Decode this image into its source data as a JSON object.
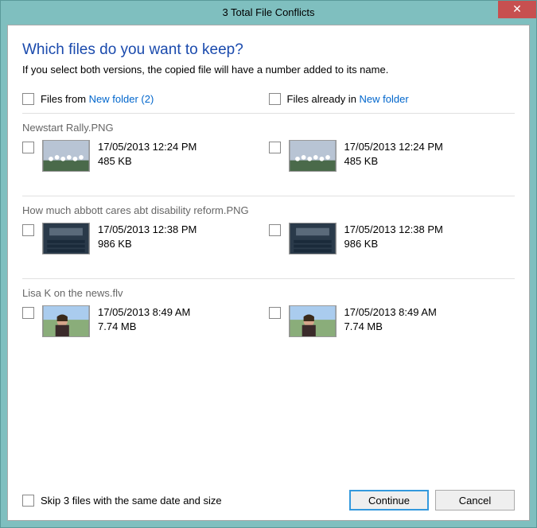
{
  "title": "3 Total File Conflicts",
  "close_icon_char": "✕",
  "heading": "Which files do you want to keep?",
  "subheading": "If you select both versions, the copied file will have a number added to its name.",
  "source": {
    "prefix": "Files from ",
    "folder": "New folder (2)"
  },
  "dest": {
    "prefix": "Files already in ",
    "folder": "New folder"
  },
  "files": [
    {
      "name": "Newstart Rally.PNG",
      "left": {
        "date": "17/05/2013 12:24 PM",
        "size": "485 KB"
      },
      "right": {
        "date": "17/05/2013 12:24 PM",
        "size": "485 KB"
      },
      "thumb": "group"
    },
    {
      "name": "How much abbott cares abt disability reform.PNG",
      "left": {
        "date": "17/05/2013 12:38 PM",
        "size": "986 KB"
      },
      "right": {
        "date": "17/05/2013 12:38 PM",
        "size": "986 KB"
      },
      "thumb": "assembly"
    },
    {
      "name": "Lisa K on the news.flv",
      "left": {
        "date": "17/05/2013 8:49 AM",
        "size": "7.74 MB"
      },
      "right": {
        "date": "17/05/2013 8:49 AM",
        "size": "7.74 MB"
      },
      "thumb": "person"
    }
  ],
  "skip_label": "Skip 3 files with the same date and size",
  "continue_label": "Continue",
  "cancel_label": "Cancel"
}
